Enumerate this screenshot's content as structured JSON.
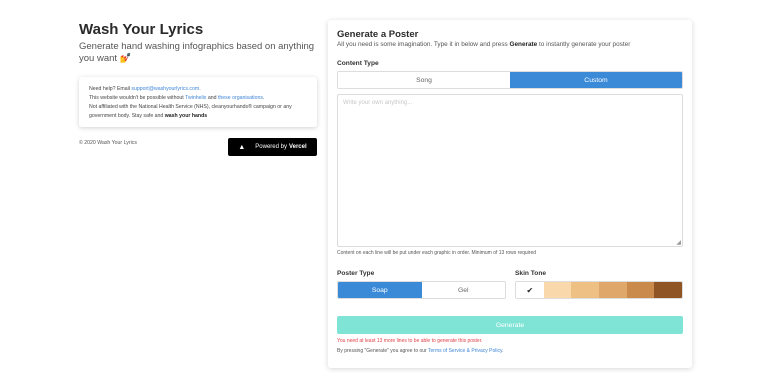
{
  "sidebar": {
    "title": "Wash Your Lyrics",
    "subtitle": "Generate hand washing infographics based on anything you want",
    "subtitle_emoji": "💅",
    "help_prefix": "Need help? Email ",
    "help_email": "support@washyourlyrics.com",
    "help_suffix": ".",
    "thanks_prefix": "This website wouldn't be possible without ",
    "thanks_link1": "Twinhelix",
    "thanks_mid": " and ",
    "thanks_link2": "these organisations",
    "thanks_suffix": ".",
    "disclaimer": "Not affiliated with the National Health Service (NHS), cleanyourhands® campaign or any government body. Stay safe and ",
    "disclaimer_bold": "wash your hands",
    "copyright": "© 2020 Wash Your Lyrics",
    "vercel_prefix": "Powered by ",
    "vercel_bold": "Vercel"
  },
  "panel": {
    "title": "Generate a Poster",
    "desc_prefix": "All you need is some imagination. Type it in below and press ",
    "desc_bold": "Generate",
    "desc_suffix": " to instantly generate your poster",
    "content_type_label": "Content Type",
    "content_types": [
      "Song",
      "Custom"
    ],
    "content_type_selected": "Custom",
    "textarea_placeholder": "Write your own anything...",
    "hint": "Content on each line will be put under each graphic in order. Minimum of 13 rows required",
    "poster_type_label": "Poster Type",
    "poster_types": [
      "Soap",
      "Gel"
    ],
    "poster_type_selected": "Soap",
    "skin_tone_label": "Skin Tone",
    "skin_tones": [
      "#ffffff",
      "#f9d9ab",
      "#efc084",
      "#e0a76a",
      "#c98a4b",
      "#8f5525"
    ],
    "skin_tone_selected_index": 0,
    "generate_label": "Generate",
    "error": "You need at least 13 more lines to be able to generate this poster.",
    "tos_prefix": "By pressing \"Generate\" you agree to our ",
    "tos_link": "Terms of Service & Privacy Policy",
    "tos_suffix": "."
  }
}
